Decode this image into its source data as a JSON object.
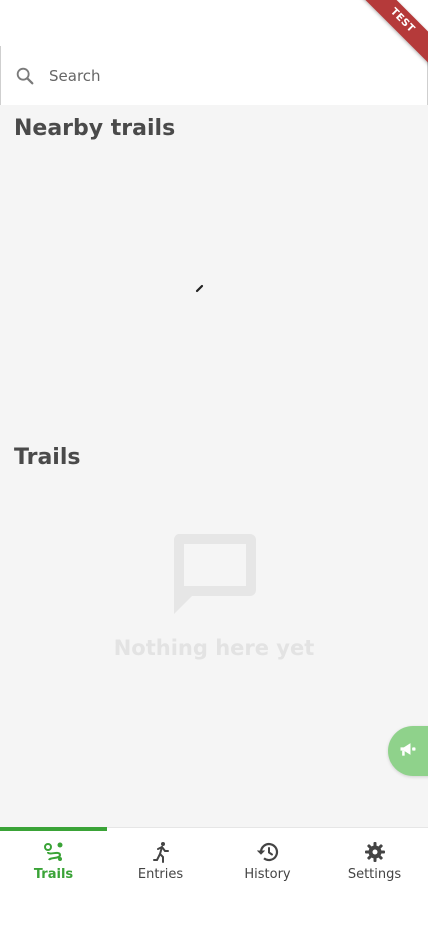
{
  "ribbon": {
    "label": "TEST",
    "color": "#b53a3a"
  },
  "search": {
    "placeholder": "Search",
    "icon": "search-icon"
  },
  "sections": {
    "nearby_title": "Nearby trails",
    "trails_title": "Trails"
  },
  "empty_state": {
    "text": "Nothing here yet",
    "icon": "chat-bubble-icon"
  },
  "fab": {
    "icon": "megaphone-icon",
    "color": "#8fd28b"
  },
  "bottom_nav": {
    "active_color": "#3aa337",
    "items": [
      {
        "label": "Trails",
        "icon": "route-icon",
        "active": true
      },
      {
        "label": "Entries",
        "icon": "running-person-icon",
        "active": false
      },
      {
        "label": "History",
        "icon": "history-icon",
        "active": false
      },
      {
        "label": "Settings",
        "icon": "gear-icon",
        "active": false
      }
    ]
  }
}
